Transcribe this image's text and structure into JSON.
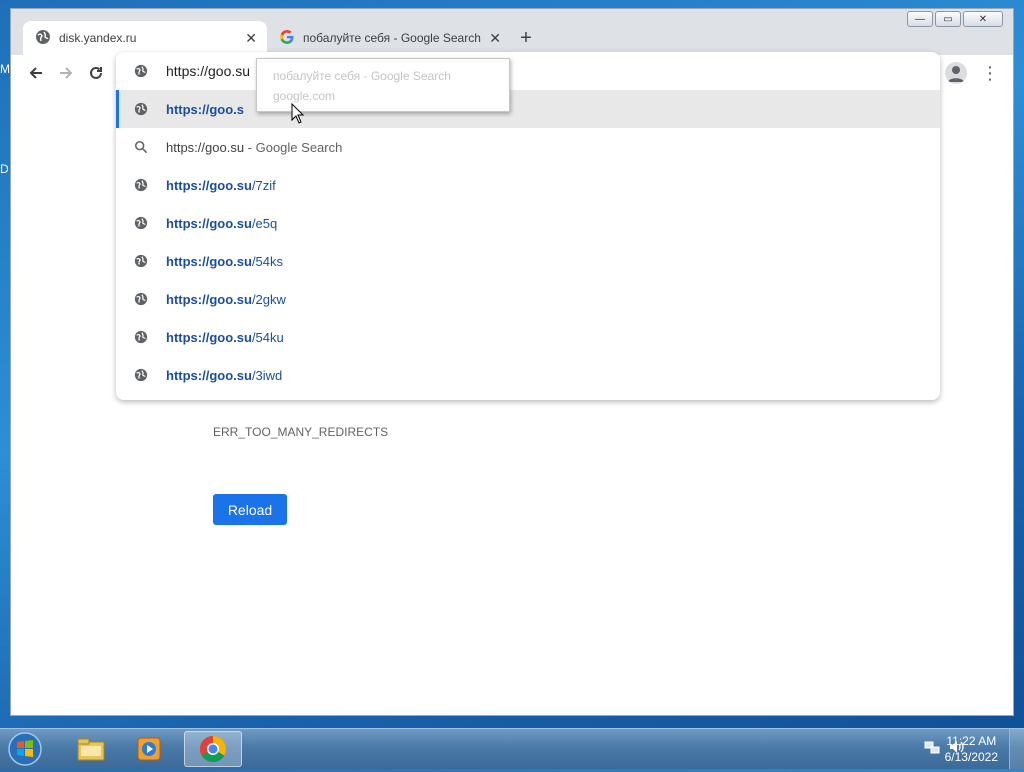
{
  "desktop": {
    "labels": [
      "M",
      "D"
    ]
  },
  "window": {
    "tabs": [
      {
        "title": "disk.yandex.ru",
        "icon": "globe-icon",
        "active": true
      },
      {
        "title": "побалуйте себя - Google Search",
        "icon": "google-icon",
        "active": false
      }
    ],
    "close_symbol": "✕",
    "new_tab_symbol": "+"
  },
  "omnibox": {
    "input_value": "https://goo.su",
    "suggestions": [
      {
        "type": "url",
        "bold": "https://goo.s",
        "rest": "",
        "selected": true
      },
      {
        "type": "search",
        "text": "https://goo.su",
        "suffix": " - Google Search"
      },
      {
        "type": "url",
        "bold": "https://goo.su",
        "rest": "/7zif"
      },
      {
        "type": "url",
        "bold": "https://goo.su",
        "rest": "/e5q"
      },
      {
        "type": "url",
        "bold": "https://goo.su",
        "rest": "/54ks"
      },
      {
        "type": "url",
        "bold": "https://goo.su",
        "rest": "/2gkw"
      },
      {
        "type": "url",
        "bold": "https://goo.su",
        "rest": "/54ku"
      },
      {
        "type": "url",
        "bold": "https://goo.su",
        "rest": "/3iwd"
      }
    ]
  },
  "tooltip": {
    "title": "побалуйте себя - Google Search",
    "domain": "google.com"
  },
  "page": {
    "error_code": "ERR_TOO_MANY_REDIRECTS",
    "reload_label": "Reload"
  },
  "taskbar": {
    "time": "11:22 AM",
    "date": "6/13/2022",
    "apps": [
      "explorer-icon",
      "media-player-icon",
      "chrome-icon"
    ]
  },
  "colors": {
    "accent": "#1a73e8",
    "link": "#1a4f9c",
    "taskbar": "#4a7aa8"
  }
}
